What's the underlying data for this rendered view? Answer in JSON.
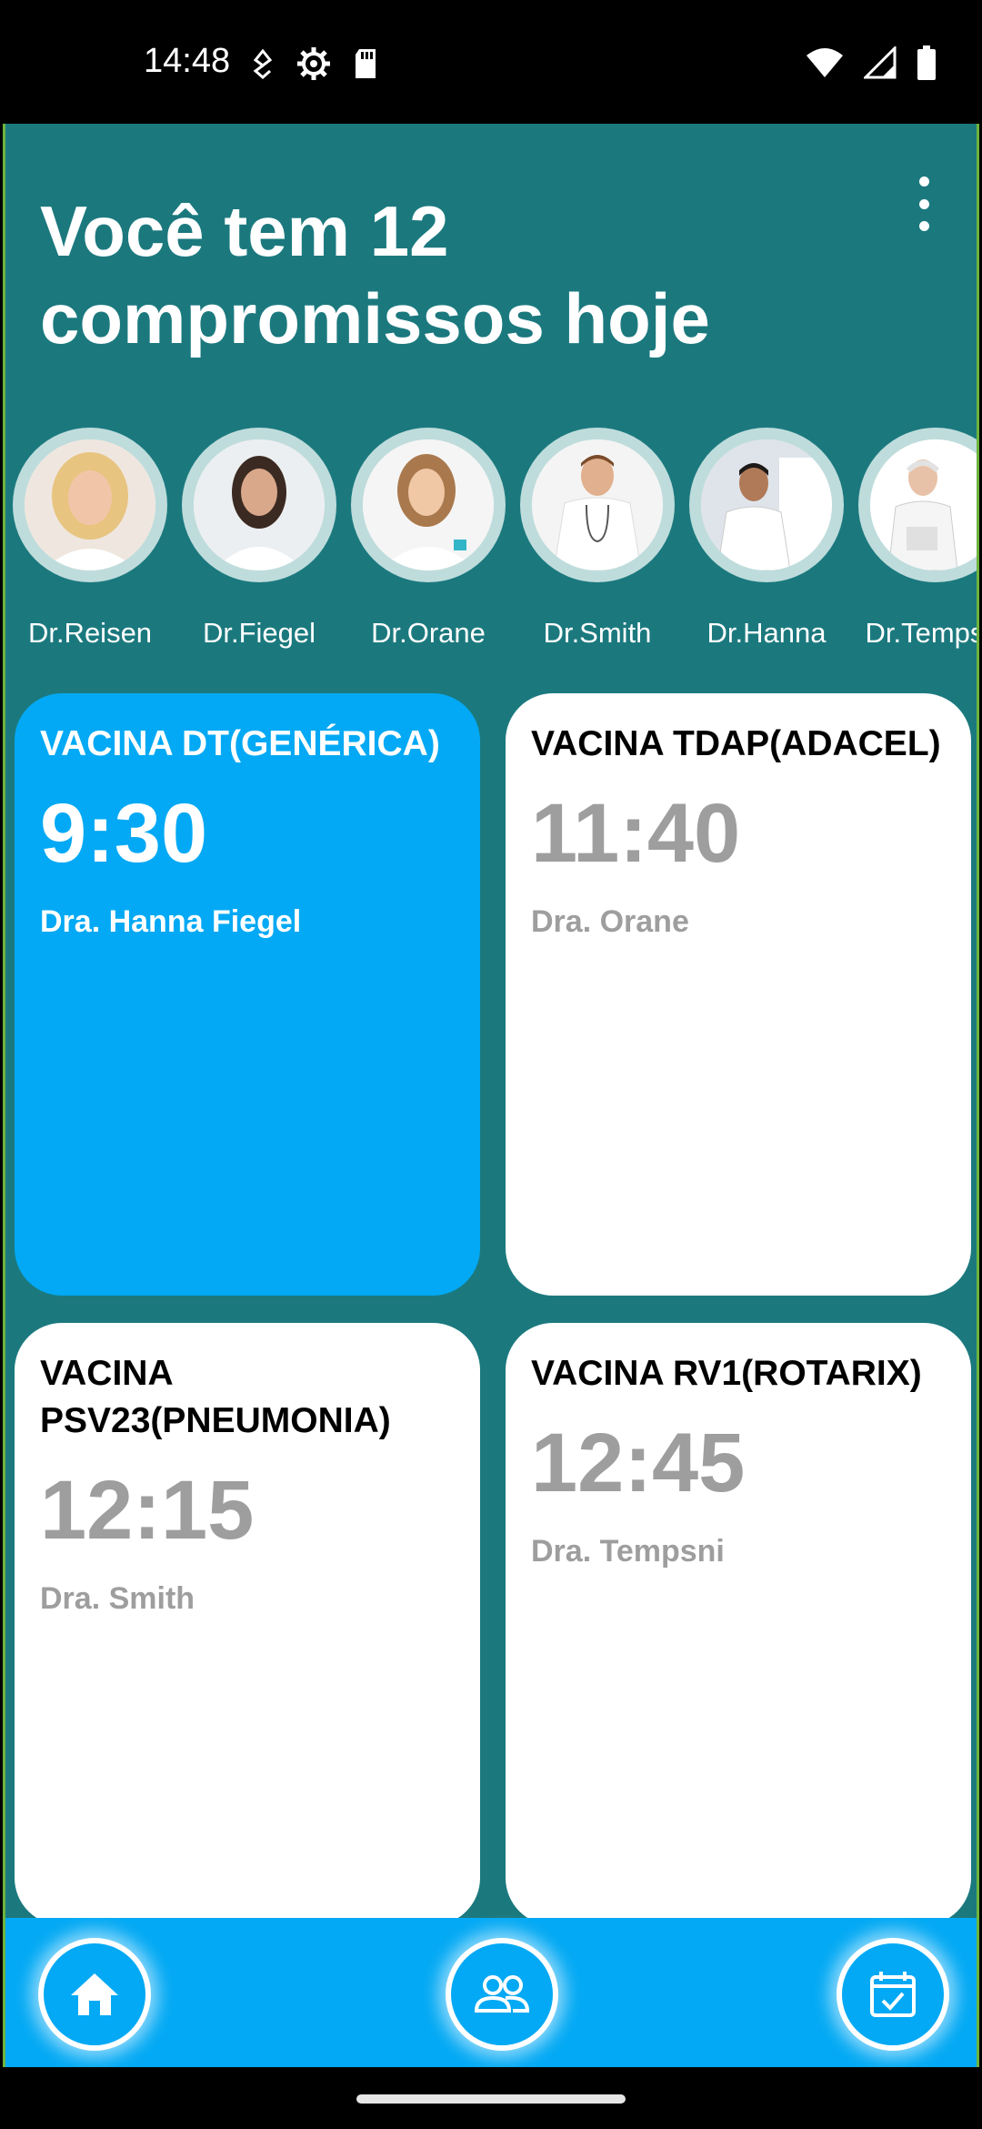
{
  "status_bar": {
    "time": "14:48",
    "left_icons": [
      "data-saver-icon",
      "settings-gear-icon",
      "sd-card-icon"
    ],
    "right_icons": [
      "wifi-icon",
      "signal-icon",
      "battery-icon"
    ]
  },
  "header": {
    "title": "Você tem 12 compromissos hoje",
    "menu_icon": "more-vert-icon"
  },
  "doctors": [
    {
      "name": "Dr.Reisen"
    },
    {
      "name": "Dr.Fiegel"
    },
    {
      "name": "Dr.Orane"
    },
    {
      "name": "Dr.Smith"
    },
    {
      "name": "Dr.Hanna"
    },
    {
      "name": "Dr.Tempsni"
    }
  ],
  "appointments": [
    {
      "title": "VACINA DT(GENÉRICA)",
      "time": "9:30",
      "doctor": "Dra. Hanna Fiegel",
      "active": true
    },
    {
      "title": "VACINA TDAP(ADACEL)",
      "time": "11:40",
      "doctor": "Dra. Orane",
      "active": false
    },
    {
      "title": "VACINA PSV23(PNEUMONIA)",
      "time": "12:15",
      "doctor": "Dra. Smith",
      "active": false
    },
    {
      "title": "VACINA RV1(ROTARIX)",
      "time": "12:45",
      "doctor": "Dra. Tempsni",
      "active": false
    }
  ],
  "bottom_nav": {
    "items": [
      "home-icon",
      "people-icon",
      "calendar-check-icon"
    ]
  },
  "colors": {
    "background": "#1b797e",
    "accent": "#03a9f4",
    "muted_text": "#9e9e9e"
  }
}
